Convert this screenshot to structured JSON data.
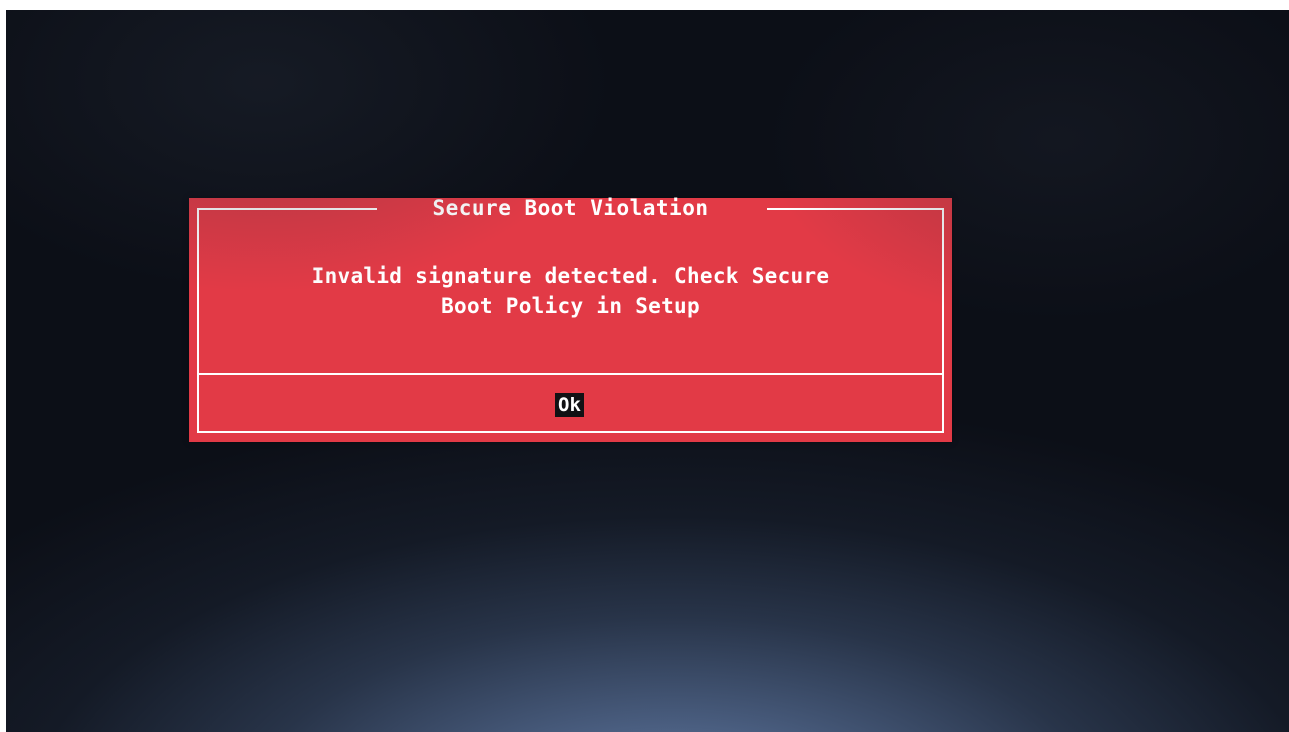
{
  "dialog": {
    "title": "Secure Boot Violation",
    "message_line1": "Invalid signature detected. Check Secure",
    "message_line2": "Boot Policy in Setup",
    "ok_label": "Ok"
  },
  "colors": {
    "dialog_background": "#e23a46",
    "dialog_border": "#ffffff",
    "screen_background": "#0c0f17",
    "selected_button_background": "#111114"
  }
}
